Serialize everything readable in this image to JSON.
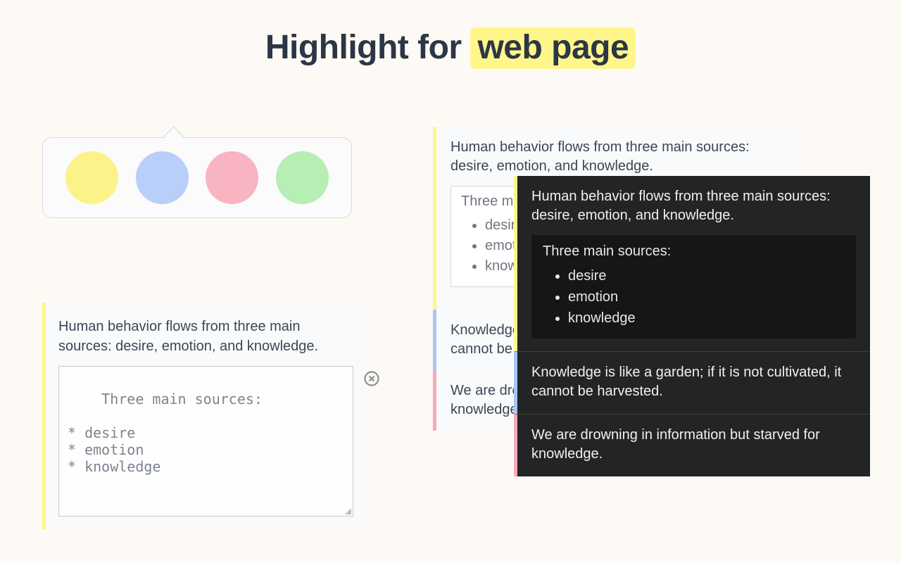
{
  "title": {
    "plain": "Highlight for ",
    "highlighted": "web page"
  },
  "picker": {
    "colors": [
      "#fcf28a",
      "#b7cff9",
      "#f8b4c1",
      "#b6eeb4"
    ]
  },
  "quotes": {
    "behavior": "Human behavior flows from three main sources: desire, emotion, and knowledge.",
    "garden": "Knowledge is like a garden; if it is not cultivated, it cannot be harvested.",
    "drowning": "We are drowning in information but starved for knowledge."
  },
  "note": {
    "title": "Three main sources:",
    "items": [
      "desire",
      "emotion",
      "knowledge"
    ],
    "raw": "Three main sources:\n\n* desire\n* emotion\n* knowledge"
  },
  "accents": {
    "yellow": "#fff68b",
    "blue": "#a9c5f7",
    "pink": "#f7a9b8"
  }
}
